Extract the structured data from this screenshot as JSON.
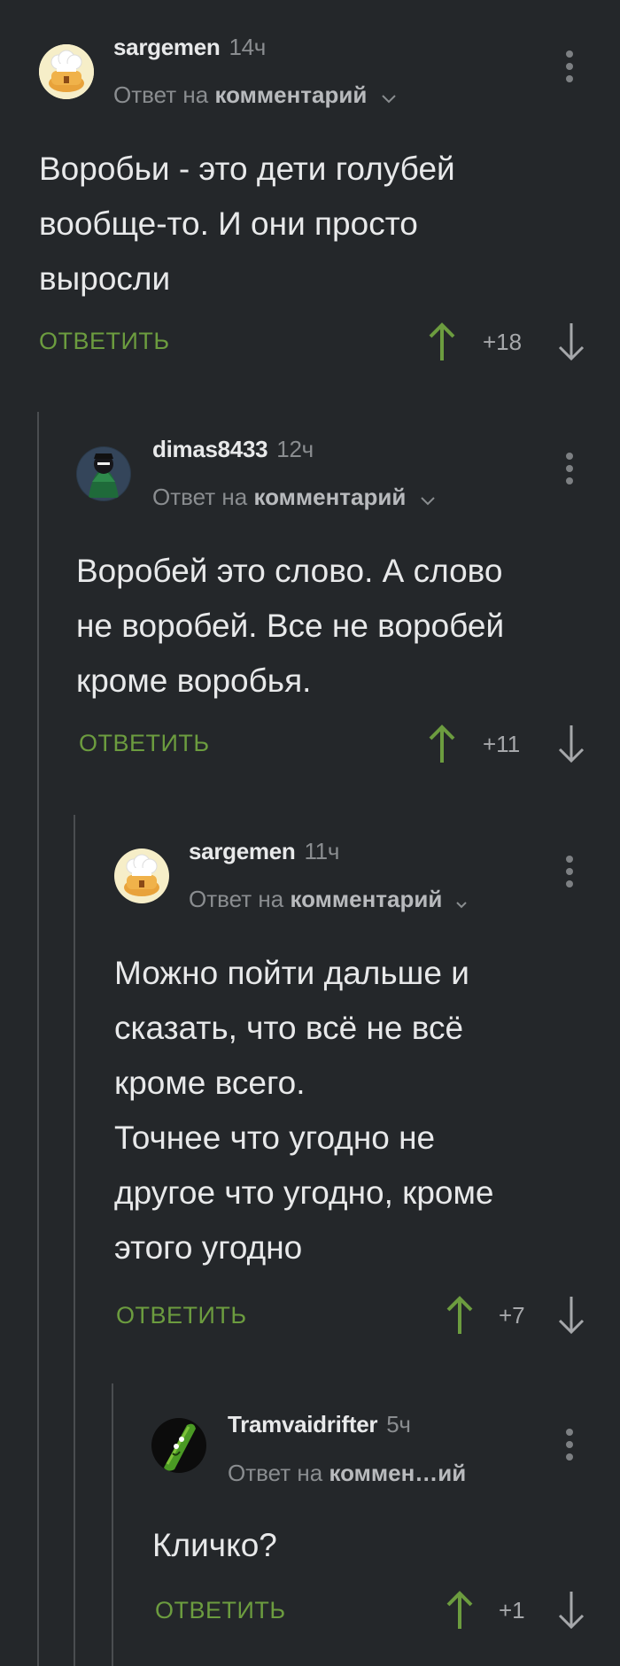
{
  "comments": [
    {
      "username": "sargemen",
      "time": "14ч",
      "reply_prefix": "Ответ на",
      "reply_target": "комментарий",
      "body": "Воробьи - это дети голубей\nвообще-то. И они просто\nвыросли",
      "reply_label": "ОТВЕТИТЬ",
      "rating": "+18",
      "avatar": "chef-bun-avatar"
    },
    {
      "username": "dimas8433",
      "time": "12ч",
      "reply_prefix": "Ответ на",
      "reply_target": "комментарий",
      "body": "Воробей это слово. А слово\nне воробей. Все не воробей\nкроме воробья.",
      "reply_label": "ОТВЕТИТЬ",
      "rating": "+11",
      "avatar": "hooded-figure-avatar"
    },
    {
      "username": "sargemen",
      "time": "11ч",
      "reply_prefix": "Ответ на",
      "reply_target": "комментарий",
      "body": "Можно пойти дальше и\nсказать, что всё не всё\nкроме всего.\nТочнее что угодно не\nдругое что угодно, кроме\nэтого угодно",
      "reply_label": "ОТВЕТИТЬ",
      "rating": "+7",
      "avatar": "chef-bun-avatar"
    },
    {
      "username": "Tramvaidrifter",
      "time": "5ч",
      "reply_prefix": "Ответ на",
      "reply_target": "коммен…ий",
      "body": "Кличко?",
      "reply_label": "ОТВЕТИТЬ",
      "rating": "+1",
      "avatar": "pickle-avatar"
    }
  ],
  "colors": {
    "background": "#24272a",
    "reply_green": "#6c9c3f",
    "thread_line": "#4a4d50",
    "muted_text": "#8a8d90"
  }
}
